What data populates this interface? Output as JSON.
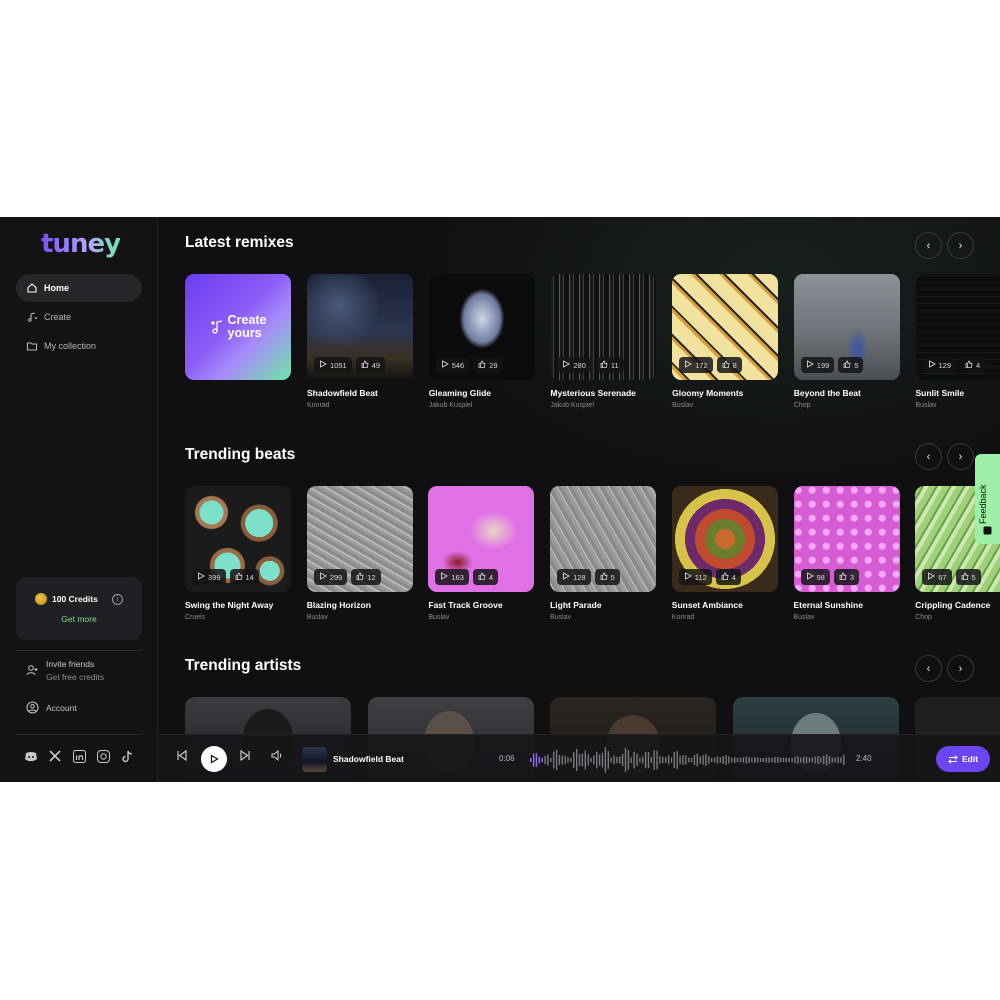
{
  "brand": {
    "logo_text": "tuney"
  },
  "sidebar": {
    "nav": [
      {
        "label": "Home",
        "icon": "home-icon",
        "active": true
      },
      {
        "label": "Create",
        "icon": "music-note-icon",
        "active": false
      },
      {
        "label": "My collection",
        "icon": "folder-icon",
        "active": false
      }
    ],
    "credits": {
      "amount_label": "100 Credits",
      "get_more_label": "Get more",
      "icon": "coin-icon"
    },
    "invite": {
      "title": "Invite friends",
      "subtitle": "Get free credits",
      "icon": "add-user-icon"
    },
    "account_label": "Account",
    "socials": [
      "discord-icon",
      "x-icon",
      "linkedin-icon",
      "instagram-icon",
      "tiktok-icon"
    ]
  },
  "sections": {
    "remixes": {
      "title": "Latest remixes",
      "create_label_1": "Create",
      "create_label_2": "yours",
      "cards": [
        {
          "title": "Shadowfield Beat",
          "artist": "Konrad",
          "plays": "1051",
          "likes": "49"
        },
        {
          "title": "Gleaming Glide",
          "artist": "Jakub Kuspiel",
          "plays": "546",
          "likes": "29"
        },
        {
          "title": "Mysterious Serenade",
          "artist": "Jakub Kuspiel",
          "plays": "280",
          "likes": "11"
        },
        {
          "title": "Gloomy Moments",
          "artist": "Buslav",
          "plays": "172",
          "likes": "8"
        },
        {
          "title": "Beyond the Beat",
          "artist": "Chop",
          "plays": "199",
          "likes": "5"
        },
        {
          "title": "Sunlit Smile",
          "artist": "Buslav",
          "plays": "129",
          "likes": "4"
        }
      ]
    },
    "beats": {
      "title": "Trending beats",
      "cards": [
        {
          "title": "Swing the Night Away",
          "artist": "Cruels",
          "plays": "399",
          "likes": "14"
        },
        {
          "title": "Blazing Horizon",
          "artist": "Buslav",
          "plays": "299",
          "likes": "12"
        },
        {
          "title": "Fast Track Groove",
          "artist": "Buslav",
          "plays": "163",
          "likes": "4"
        },
        {
          "title": "Light Parade",
          "artist": "Buslav",
          "plays": "128",
          "likes": "5"
        },
        {
          "title": "Sunset Ambiance",
          "artist": "Konrad",
          "plays": "112",
          "likes": "4"
        },
        {
          "title": "Eternal Sunshine",
          "artist": "Buslav",
          "plays": "98",
          "likes": "3"
        },
        {
          "title": "Crippling Cadence",
          "artist": "Chop",
          "plays": "67",
          "likes": "5"
        }
      ]
    },
    "artists": {
      "title": "Trending artists"
    }
  },
  "player": {
    "track": "Shadowfield Beat",
    "current_time": "0:06",
    "total_time": "2:40",
    "edit_label": "Edit",
    "progress": 0.04
  },
  "feedback_label": "Feedback",
  "colors": {
    "accent": "#6b46f0",
    "green": "#7fdf8f",
    "bg": "#101012"
  }
}
